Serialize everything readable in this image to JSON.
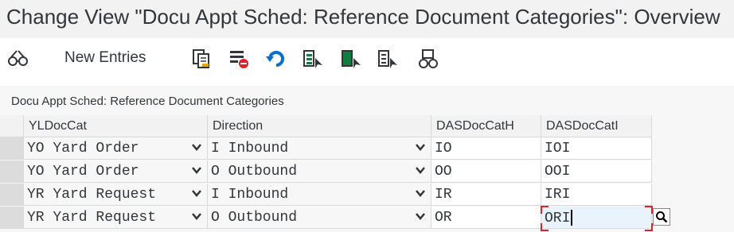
{
  "window": {
    "title": "Change View \"Docu Appt Sched: Reference Document Categories\": Overview"
  },
  "toolbar": {
    "new_entries_label": "New Entries"
  },
  "section": {
    "title": "Docu Appt Sched: Reference Document Categories"
  },
  "table": {
    "columns": [
      "YLDocCat",
      "Direction",
      "DASDocCatH",
      "DASDocCatI"
    ],
    "rows": [
      {
        "yldoccat": "YO Yard Order",
        "direction": "I Inbound",
        "dasdoccath": "IO",
        "dasdoccati": "IOI"
      },
      {
        "yldoccat": "YO Yard Order",
        "direction": "O Outbound",
        "dasdoccath": "OO",
        "dasdoccati": "OOI"
      },
      {
        "yldoccat": "YR Yard Request",
        "direction": "I Inbound",
        "dasdoccath": "IR",
        "dasdoccati": "IRI"
      },
      {
        "yldoccat": "YR Yard Request",
        "direction": "O Outbound",
        "dasdoccath": "OR",
        "dasdoccati": "ORI"
      }
    ]
  },
  "colors": {
    "accent_blue": "#0a6ed1",
    "accent_green": "#107e3e",
    "focus_red": "#e0202a"
  }
}
